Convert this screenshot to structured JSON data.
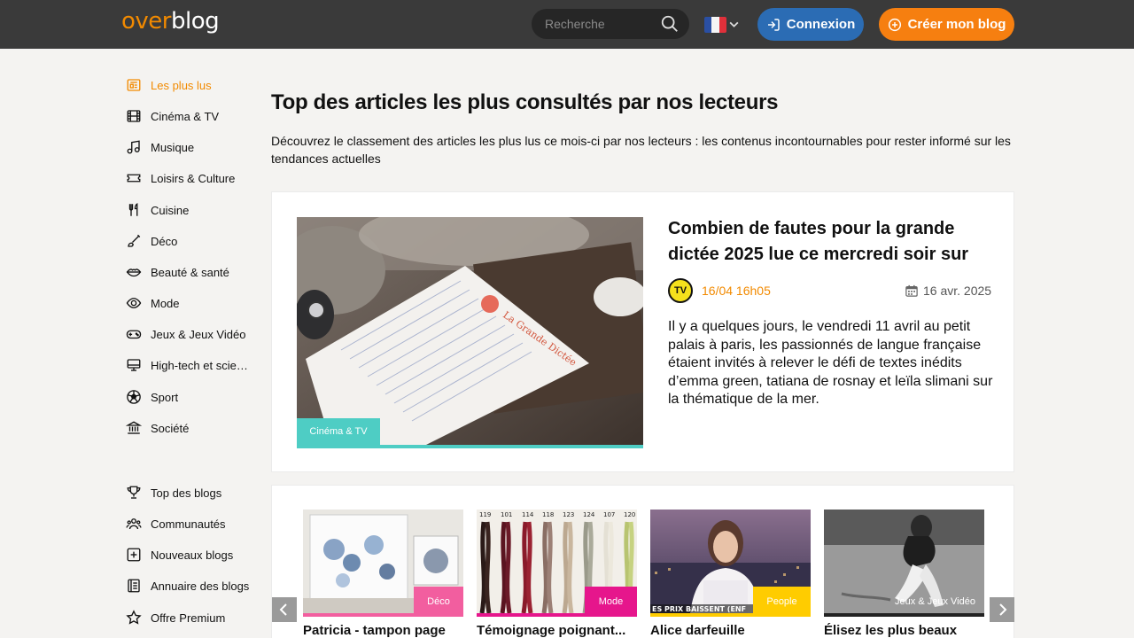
{
  "header": {
    "logo_part1": "over",
    "logo_part2": "blog",
    "search_placeholder": "Recherche",
    "language": "FR",
    "login_label": "Connexion",
    "create_label": "Créer mon blog",
    "colors": {
      "bar": "#3a3a3a",
      "login": "#2b6cb4",
      "create": "#f67f10",
      "accent": "#f28a00"
    }
  },
  "sidebar": {
    "categories": [
      {
        "label": "Les plus lus",
        "icon": "newspaper-icon",
        "active": true
      },
      {
        "label": "Cinéma & TV",
        "icon": "film-icon"
      },
      {
        "label": "Musique",
        "icon": "music-note-icon"
      },
      {
        "label": "Loisirs & Culture",
        "icon": "ticket-icon"
      },
      {
        "label": "Cuisine",
        "icon": "utensils-icon"
      },
      {
        "label": "Déco",
        "icon": "paintbrush-icon"
      },
      {
        "label": "Beauté & santé",
        "icon": "lips-icon"
      },
      {
        "label": "Mode",
        "icon": "eye-icon"
      },
      {
        "label": "Jeux & Jeux Vidéo",
        "icon": "gamepad-icon"
      },
      {
        "label": "High-tech et scien…",
        "icon": "monitor-icon"
      },
      {
        "label": "Sport",
        "icon": "soccer-ball-icon"
      },
      {
        "label": "Société",
        "icon": "institution-icon"
      }
    ],
    "links": [
      {
        "label": "Top des blogs",
        "icon": "trophy-icon"
      },
      {
        "label": "Communautés",
        "icon": "users-icon"
      },
      {
        "label": "Nouveaux blogs",
        "icon": "plus-square-icon"
      },
      {
        "label": "Annuaire des blogs",
        "icon": "directory-icon"
      },
      {
        "label": "Offre Premium",
        "icon": "star-icon"
      }
    ]
  },
  "main": {
    "title": "Top des articles les plus consultés par nos lecteurs",
    "description": "Découvrez le classement des articles les plus lus ce mois-ci par nos lecteurs : les contenus incontournables pour rester informé sur les tendances actuelles",
    "featured": {
      "category": "Cinéma & TV",
      "title": "Combien de fautes pour la grande dictée 2025 lue ce mercredi soir sur",
      "source_logo_text": "TV",
      "time": "16/04 16h05",
      "date": "16 avr. 2025",
      "excerpt": "Il y a quelques jours, le vendredi 11 avril au petit palais à paris, les passionnés de langue française étaient invités à relever le défi de textes inédits d’emma green, tatiana de rosnay et leïla slimani sur la thématique de la mer.",
      "image_text": "La Grande Dictée",
      "category_color": "#4ecdc4"
    },
    "carousel": [
      {
        "title": "Patricia - tampon page",
        "category": "Déco",
        "color": "#f25e9f"
      },
      {
        "title": "Témoignage poignant...",
        "category": "Mode",
        "color": "#e6168c",
        "swatch_numbers": [
          "119",
          "101",
          "114",
          "118",
          "123",
          "124",
          "107",
          "120"
        ]
      },
      {
        "title": "Alice darfeuille",
        "category": "People",
        "color": "#ffcc00",
        "image_caption": "ES PRIX BAISSENT (ENF"
      },
      {
        "title": "Élisez les plus beaux",
        "category": "Jeux & Jeux Vidéo",
        "color": "#222222"
      }
    ]
  }
}
